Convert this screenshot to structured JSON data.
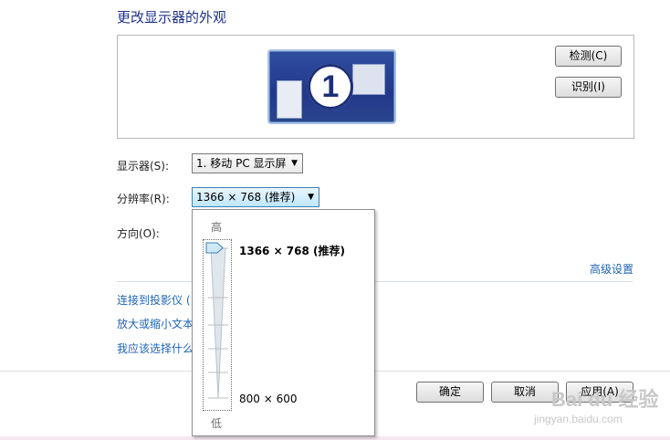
{
  "page": {
    "title": "更改显示器的外观"
  },
  "preview": {
    "monitor_number": "1",
    "detect_label": "检测(C)",
    "identify_label": "识别(I)"
  },
  "settings": {
    "display_label": "显示器(S):",
    "display_value": "1. 移动 PC 显示屏",
    "resolution_label": "分辨率(R):",
    "resolution_value": "1366 × 768 (推荐)",
    "orientation_label": "方向(O):"
  },
  "links": {
    "advanced": "高级设置",
    "connect_projector": "连接到投影仪 (",
    "text_size": "放大或缩小文本",
    "which_settings": "我应该选择什么"
  },
  "footer": {
    "ok_label": "确定",
    "cancel_label": "取消",
    "apply_label": "应用(A)"
  },
  "resolution_dropdown": {
    "high_label": "高",
    "low_label": "低",
    "max_resolution": "1366 × 768 (推荐)",
    "min_resolution": "800 × 600",
    "slider_level": 1.0
  },
  "watermark": {
    "brand": "Bai du 经验",
    "url": "jingyan.baidu.com"
  },
  "icons": {
    "dropdown_arrow": "chevron-down-icon",
    "slider_thumb": "slider-thumb-icon"
  }
}
